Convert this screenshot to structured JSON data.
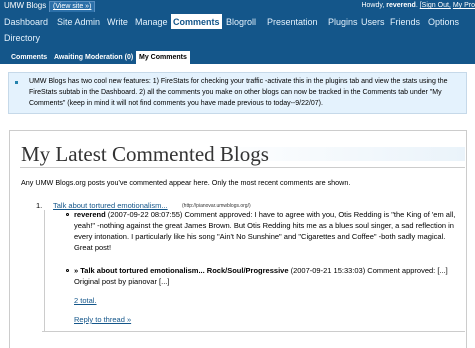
{
  "topbar": {
    "site_name": "UMW Blogs",
    "view_site": "(View site »)",
    "howdy": "Howdy,",
    "username": "reverend",
    "sign_out": "[Sign Out,",
    "my_profile": "My Pro"
  },
  "menu": {
    "items": [
      "Dashboard",
      "Site Admin",
      "Write",
      "Manage",
      "Comments",
      "Blogroll",
      "Presentation",
      "Plugins",
      "Users",
      "Friends",
      "Options",
      "Directory"
    ],
    "active": "Comments"
  },
  "submenu": {
    "items": [
      "Comments",
      "Awaiting Moderation (0)",
      "My Comments"
    ],
    "active": "My Comments"
  },
  "notice": {
    "text": "UMW Blogs has two cool new features: 1) FireStats for checking your traffic -activate this in the plugins tab and view the stats using the FireStats subtab in the Dashboard. 2) all the comments you make on other blogs can now be tracked in the Comments tab under \"My Comments\" (keep in mind it will not find comments you have made previous to today--9/22/07)."
  },
  "main": {
    "title": "My Latest Commented Blogs",
    "intro": "Any UMW Blogs.org posts you've commented appear here. Only the most recent comments are shown.",
    "posts": [
      {
        "number": "1.",
        "title": "Talk about tortured emotionalism...",
        "url": "(http://pianovar.umwblogs.org/)",
        "comments": [
          {
            "author": "reverend",
            "meta": " (2007-09-22 08:07:55) Comment approved: I have to agree with you, Otis Redding is \"the King of 'em all, yeah!\" -nothing against the great James Brown. But Otis Redding hits me as a blues soul singer, a sad reflection in every intonation. I particularly like his song \"Ain't No Sunshine\" and \"Cigarettes and Coffee\" -both sadly magical. Great post!"
          },
          {
            "author": "» Talk about tortured emotionalism... Rock/Soul/Progressive",
            "meta": " (2007-09-21 15:33:03) Comment approved: [...] Original post by pianovar [...]"
          }
        ],
        "total": "2 total.",
        "reply": "Reply to thread »"
      }
    ]
  },
  "colors": {
    "header_bg": "#14568a",
    "notice_bg": "#e4f2fd",
    "link": "#14568a"
  }
}
